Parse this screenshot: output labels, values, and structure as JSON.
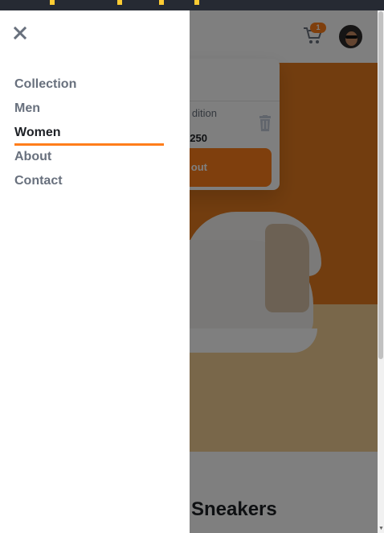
{
  "menu": {
    "items": [
      {
        "label": "Collection"
      },
      {
        "label": "Men"
      },
      {
        "label": "Women"
      },
      {
        "label": "About"
      },
      {
        "label": "Contact"
      }
    ],
    "active_index": 2
  },
  "header": {
    "cart_count": "1"
  },
  "cart": {
    "item_name_partial": "dition",
    "item_price_partial": "250",
    "checkout_label_partial": "out"
  },
  "product": {
    "title_partial": "Sneakers"
  },
  "colors": {
    "accent": "#ff7e1b",
    "text_dark": "#1d2025",
    "text_muted": "#68707d"
  }
}
